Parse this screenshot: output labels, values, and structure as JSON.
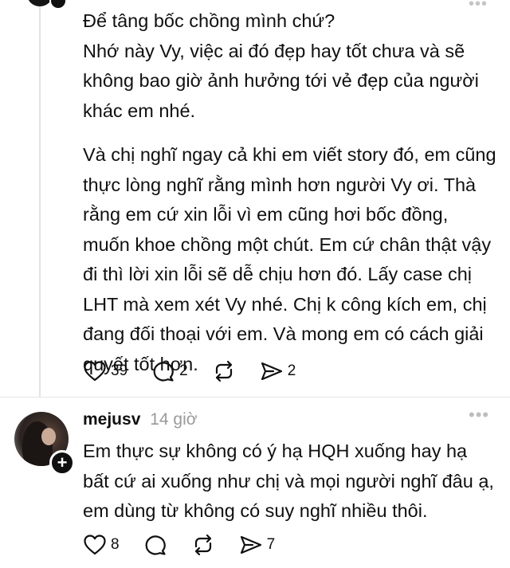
{
  "post1": {
    "paragraphs": [
      "Để tâng bốc chồng mình chứ?\nNhớ này Vy, việc ai đó đẹp hay tốt chưa và sẽ không bao giờ ảnh hưởng tới vẻ đẹp của người khác em nhé.",
      "Và chị nghĩ ngay cả khi em viết story đó, em cũng thực lòng nghĩ rằng mình hơn người Vy ơi. Thà rằng em cứ xin lỗi vì em cũng hơi bốc đồng, muốn khoe chồng một chút. Em cứ chân thật vậy đi thì lời xin lỗi sẽ dễ chịu hơn đó. Lấy case chị LHT mà xem xét Vy nhé. Chị k công kích em, chị đang đối thoại với em. Và mong em có cách giải quyết tốt hơn."
    ],
    "like_count": "39",
    "comment_count": "2",
    "share_count": "2"
  },
  "post2": {
    "username": "mejusv",
    "time": "14 giờ",
    "text": "Em thực sự không có ý hạ HQH xuống hay hạ bất cứ ai xuống như chị và mọi người nghĩ đâu ạ, em dùng từ không có suy nghĩ nhiều thôi.",
    "like_count": "8",
    "share_count": "7"
  },
  "icons": {
    "like": "heart-icon",
    "comment": "comment-bubble-icon",
    "repost": "repost-icon",
    "share": "send-icon",
    "more": "more-dots-icon",
    "follow": "plus-icon"
  },
  "colors": {
    "text": "#101010",
    "muted": "#9a9a9a",
    "divider": "#e5e5e5"
  }
}
